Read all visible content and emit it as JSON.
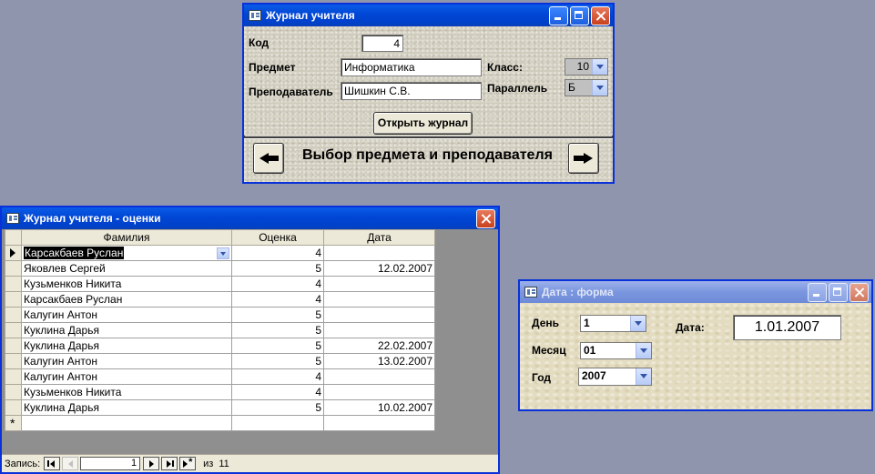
{
  "journal_window": {
    "title": "Журнал учителя",
    "labels": {
      "code": "Код",
      "subject": "Предмет",
      "teacher": "Преподаватель",
      "class": "Класс:",
      "parallel": "Параллель"
    },
    "values": {
      "code": "4",
      "subject": "Информатика",
      "teacher": "Шишкин С.В.",
      "class": "10",
      "parallel": "Б"
    },
    "open_button": "Открыть журнал",
    "caption": "Выбор предмета и преподавателя"
  },
  "grades_window": {
    "title": "Журнал учителя - оценки",
    "columns": [
      "Фамилия",
      "Оценка",
      "Дата"
    ],
    "rows": [
      {
        "name": "Карсакбаев Руслан",
        "grade": "4",
        "date": ""
      },
      {
        "name": "Яковлев Сергей",
        "grade": "5",
        "date": "12.02.2007"
      },
      {
        "name": "Кузьменков Никита",
        "grade": "4",
        "date": ""
      },
      {
        "name": "Карсакбаев Руслан",
        "grade": "4",
        "date": ""
      },
      {
        "name": "Калугин Антон",
        "grade": "5",
        "date": ""
      },
      {
        "name": "Куклина Дарья",
        "grade": "5",
        "date": ""
      },
      {
        "name": "Куклина Дарья",
        "grade": "5",
        "date": "22.02.2007"
      },
      {
        "name": "Калугин Антон",
        "grade": "5",
        "date": "13.02.2007"
      },
      {
        "name": "Калугин Антон",
        "grade": "4",
        "date": ""
      },
      {
        "name": "Кузьменков Никита",
        "grade": "4",
        "date": ""
      },
      {
        "name": "Куклина Дарья",
        "grade": "5",
        "date": "10.02.2007"
      }
    ],
    "nav": {
      "record_label": "Запись:",
      "current": "1",
      "of_label": "из",
      "total": "11"
    }
  },
  "date_window": {
    "title": "Дата : форма",
    "labels": {
      "day": "День",
      "month": "Месяц",
      "year": "Год",
      "date": "Дата:"
    },
    "values": {
      "day": "1",
      "month": "01",
      "year": "2007",
      "date": "1.01.2007"
    }
  }
}
